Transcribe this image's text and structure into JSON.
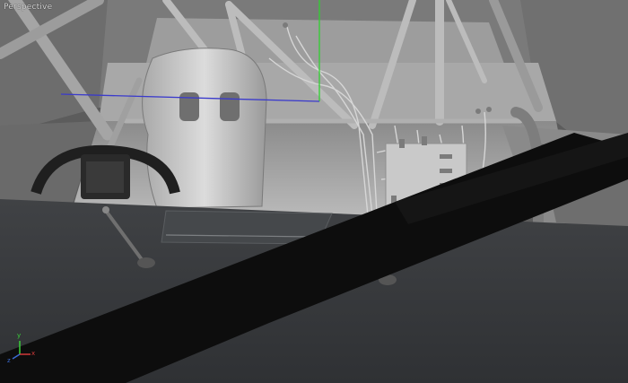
{
  "viewport": {
    "label": "Perspective",
    "accent_colors": {
      "x_axis": "#d23a3a",
      "y_axis": "#3ad23a",
      "z_axis": "#3a6ad2",
      "manipulator_blue": "#3a3acc",
      "manipulator_green": "#2fd12f"
    }
  },
  "axis_gizmo": {
    "x_label": "x",
    "y_label": "y",
    "z_label": "z"
  }
}
